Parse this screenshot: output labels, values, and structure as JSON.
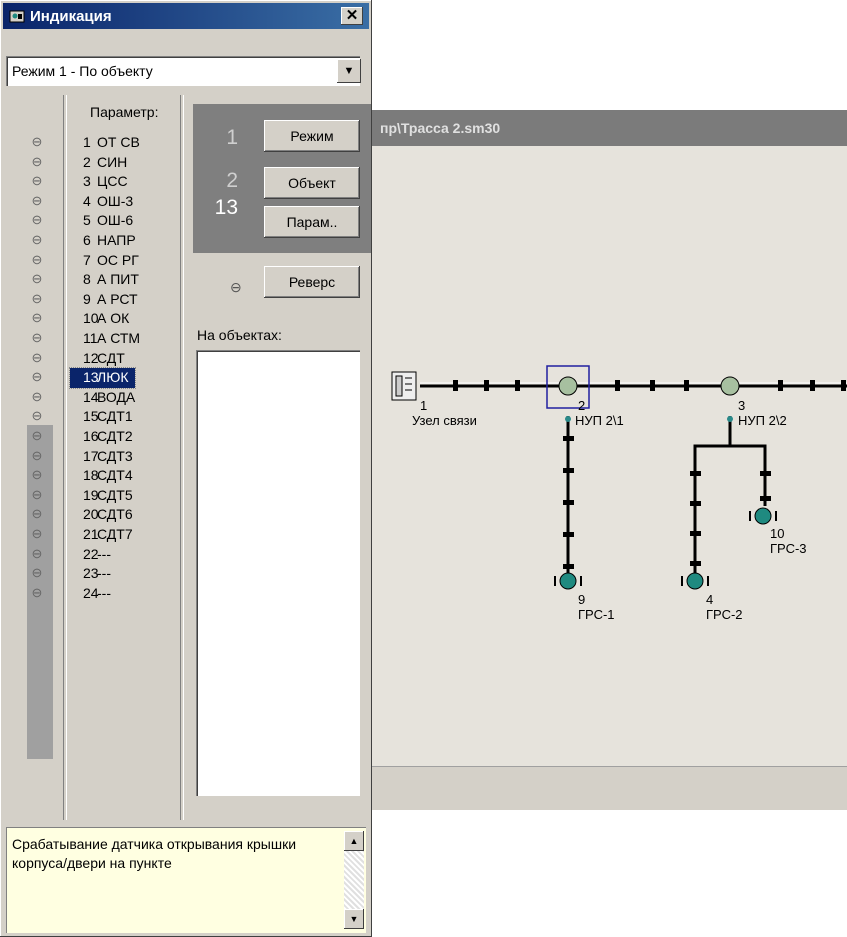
{
  "panel": {
    "title": "Индикация",
    "close_glyph": "✕",
    "mode": "Режим 1 -  По объекту",
    "param_header": "Параметр:",
    "params": [
      {
        "n": "1",
        "label": "ОТ СВ"
      },
      {
        "n": "2",
        "label": "СИН"
      },
      {
        "n": "3",
        "label": "ЦСС"
      },
      {
        "n": "4",
        "label": "ОШ-3"
      },
      {
        "n": "5",
        "label": "ОШ-6"
      },
      {
        "n": "6",
        "label": "НАПР"
      },
      {
        "n": "7",
        "label": "ОС РГ"
      },
      {
        "n": "8",
        "label": "А ПИТ"
      },
      {
        "n": "9",
        "label": "А РСТ"
      },
      {
        "n": "10",
        "label": "А ОК"
      },
      {
        "n": "11",
        "label": "А СТМ"
      },
      {
        "n": "12",
        "label": "СДТ"
      },
      {
        "n": "13",
        "label": "ЛЮК"
      },
      {
        "n": "14",
        "label": "ВОДА"
      },
      {
        "n": "15",
        "label": "СДТ1"
      },
      {
        "n": "16",
        "label": "СДТ2"
      },
      {
        "n": "17",
        "label": "СДТ3"
      },
      {
        "n": "18",
        "label": "СДТ4"
      },
      {
        "n": "19",
        "label": "СДТ5"
      },
      {
        "n": "20",
        "label": "СДТ6"
      },
      {
        "n": "21",
        "label": "СДТ7"
      },
      {
        "n": "22",
        "label": "---"
      },
      {
        "n": "23",
        "label": "---"
      },
      {
        "n": "24",
        "label": "---"
      }
    ],
    "selected_param": "13",
    "led_glyph": "⊖",
    "counters": {
      "mode_value": "1",
      "object_value": "2",
      "param_value": "13"
    },
    "buttons": {
      "mode": "Режим",
      "object": "Объект",
      "param": "Парам..",
      "reverse": "Реверс"
    },
    "objects_label": "На объектах:",
    "description": "Срабатывание датчика открывания крышки корпуса/двери на пункте",
    "scroll_up": "▲",
    "scroll_down": "▼",
    "dropdown_arrow": "▼"
  },
  "map": {
    "title": "пр\\Трасса 2.sm30",
    "nodes": [
      {
        "num": "1",
        "name": "Узел связи"
      },
      {
        "num": "2",
        "name": "НУП 2\\1"
      },
      {
        "num": "3",
        "name": "НУП 2\\2"
      },
      {
        "num": "9",
        "name": "ГРС-1"
      },
      {
        "num": "4",
        "name": "ГРС-2"
      },
      {
        "num": "10",
        "name": "ГРС-3"
      }
    ]
  }
}
